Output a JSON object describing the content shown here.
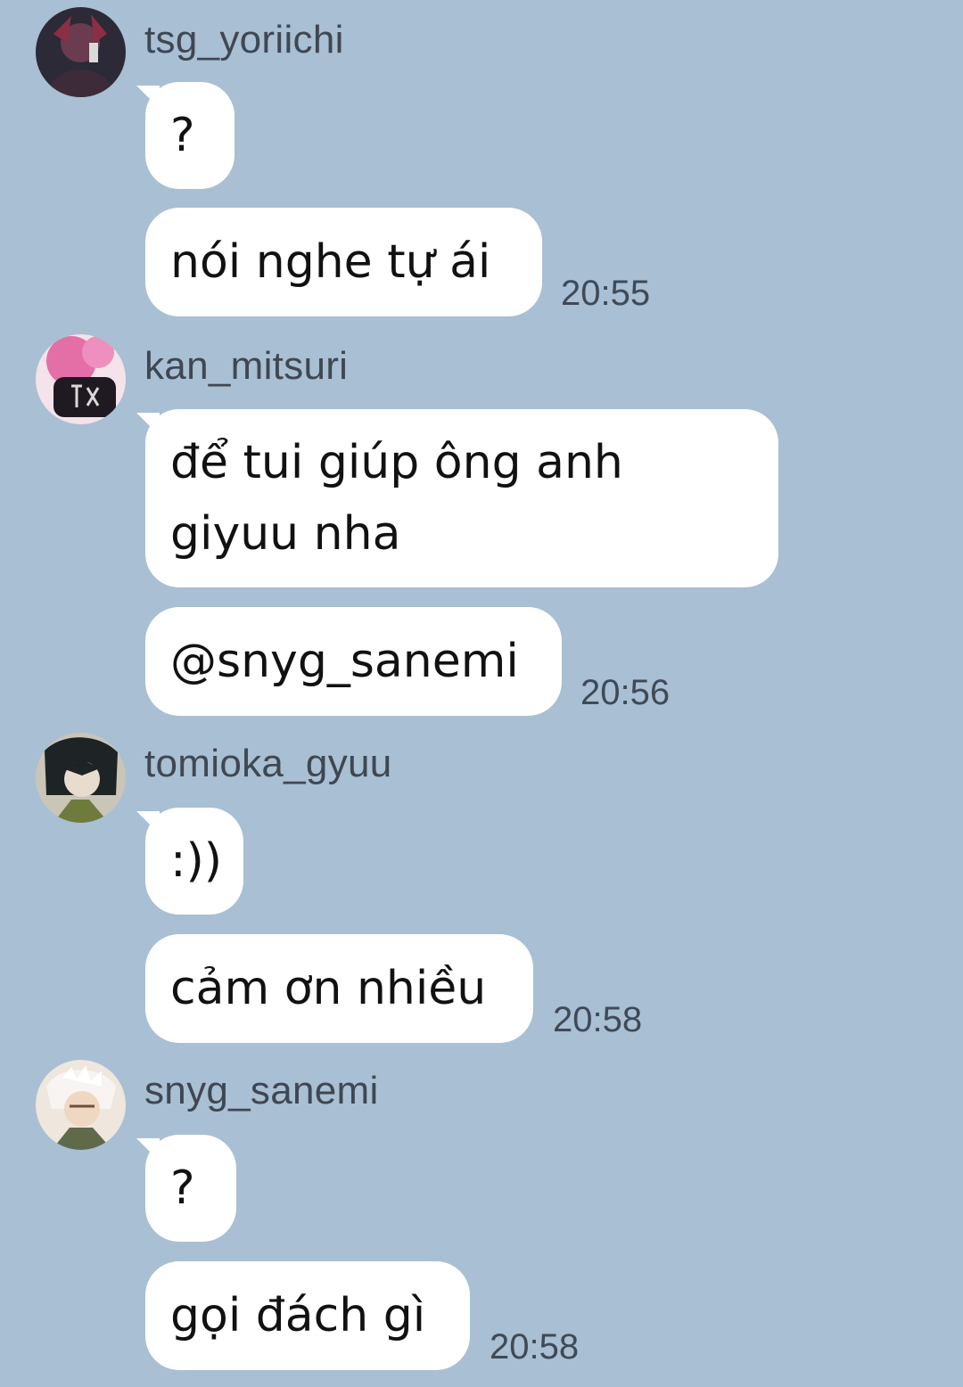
{
  "background_color": "#A9BFD3",
  "messages": [
    {
      "username": "tsg_yoriichi",
      "avatar": "avatar-yoriichi",
      "bubbles": [
        "?",
        "nói nghe tự ái"
      ],
      "time": "20:55"
    },
    {
      "username": "kan_mitsuri",
      "avatar": "avatar-mitsuri",
      "bubbles": [
        "để tui giúp ông anh\ngiyuu nha",
        "@snyg_sanemi"
      ],
      "time": "20:56"
    },
    {
      "username": "tomioka_gyuu",
      "avatar": "avatar-giyuu",
      "bubbles": [
        ":))",
        "cảm ơn nhiều"
      ],
      "time": "20:58"
    },
    {
      "username": "snyg_sanemi",
      "avatar": "avatar-sanemi",
      "bubbles": [
        "?",
        "gọi đách gì"
      ],
      "time": "20:58"
    }
  ]
}
